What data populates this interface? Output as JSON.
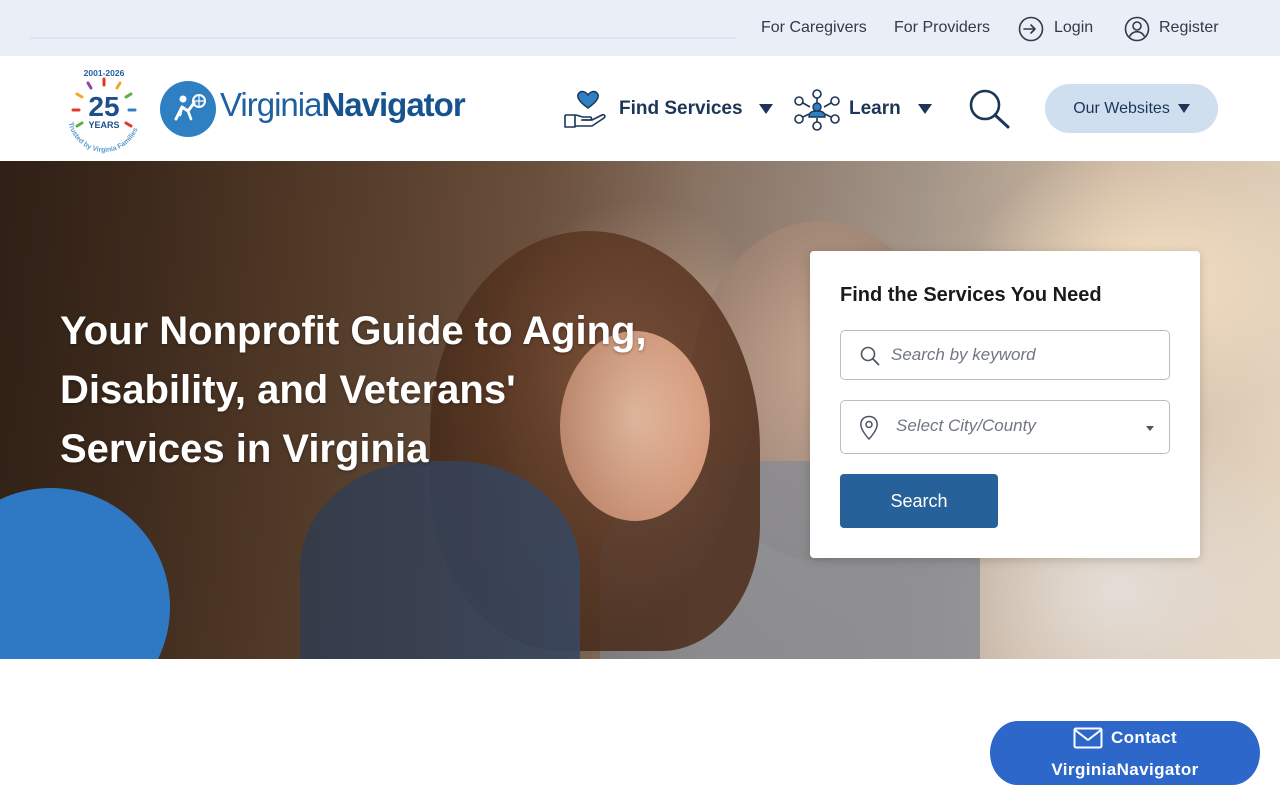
{
  "utility_nav": {
    "caregivers": "For Caregivers",
    "providers": "For Providers",
    "login": "Login",
    "register": "Register"
  },
  "logo": {
    "badge_years": "2001-2026",
    "badge_number": "25",
    "badge_word": "YEARS",
    "badge_tagline": "Trusted by Virginia Families",
    "name_regular": "Virginia",
    "name_bold": "Navigator"
  },
  "main_nav": {
    "find_services": "Find Services",
    "learn": "Learn",
    "our_websites": "Our Websites"
  },
  "hero": {
    "title": "Your Nonprofit Guide to Aging, Disability, and Veterans' Services in Virginia"
  },
  "search_card": {
    "title": "Find the Services You Need",
    "keyword_placeholder": "Search by keyword",
    "location_placeholder": "Select City/County",
    "submit_label": "Search"
  },
  "contact": {
    "line1": "Contact",
    "line2": "VirginiaNavigator"
  },
  "colors": {
    "utility_bg": "#e9eef7",
    "brand_blue": "#2f80c3",
    "nav_text": "#1d3557",
    "websites_btn_bg": "#cfdff0",
    "search_btn_bg": "#27619a",
    "contact_bg": "#2d67c9",
    "hero_circle": "#2f78c3"
  }
}
